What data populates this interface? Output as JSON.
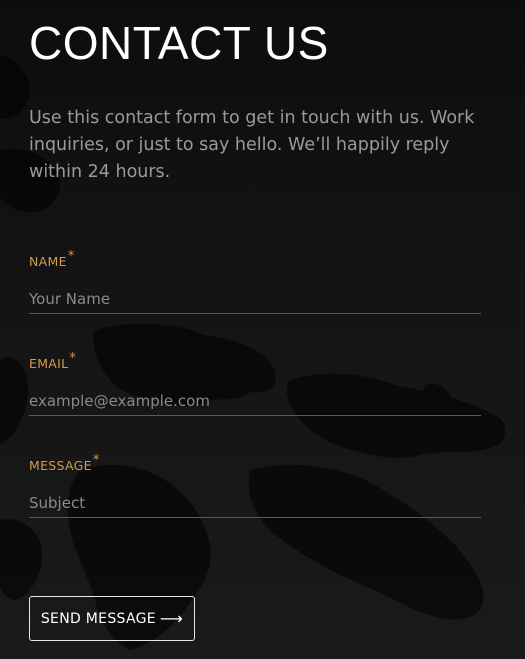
{
  "page": {
    "title": "CONTACT US",
    "intro": "Use this contact form to get in touch with us. Work inquiries, or just to say hello. We’ll happily reply within 24 hours."
  },
  "form": {
    "fields": [
      {
        "label": "NAME",
        "required_mark": "*",
        "placeholder": "Your Name",
        "value": ""
      },
      {
        "label": "EMAIL",
        "required_mark": "*",
        "placeholder": "example@example.com",
        "value": ""
      },
      {
        "label": "MESSAGE",
        "required_mark": "*",
        "placeholder": "Subject",
        "value": ""
      }
    ],
    "submit_label": "SEND MESSAGE",
    "submit_icon": "arrow-right-icon"
  },
  "colors": {
    "background": "#141414",
    "label_accent": "#d49a4e",
    "title": "#ffffff",
    "intro_text": "#9a9a9a",
    "input_underline": "#5a5a5a",
    "button_border": "#e8e8e8"
  }
}
